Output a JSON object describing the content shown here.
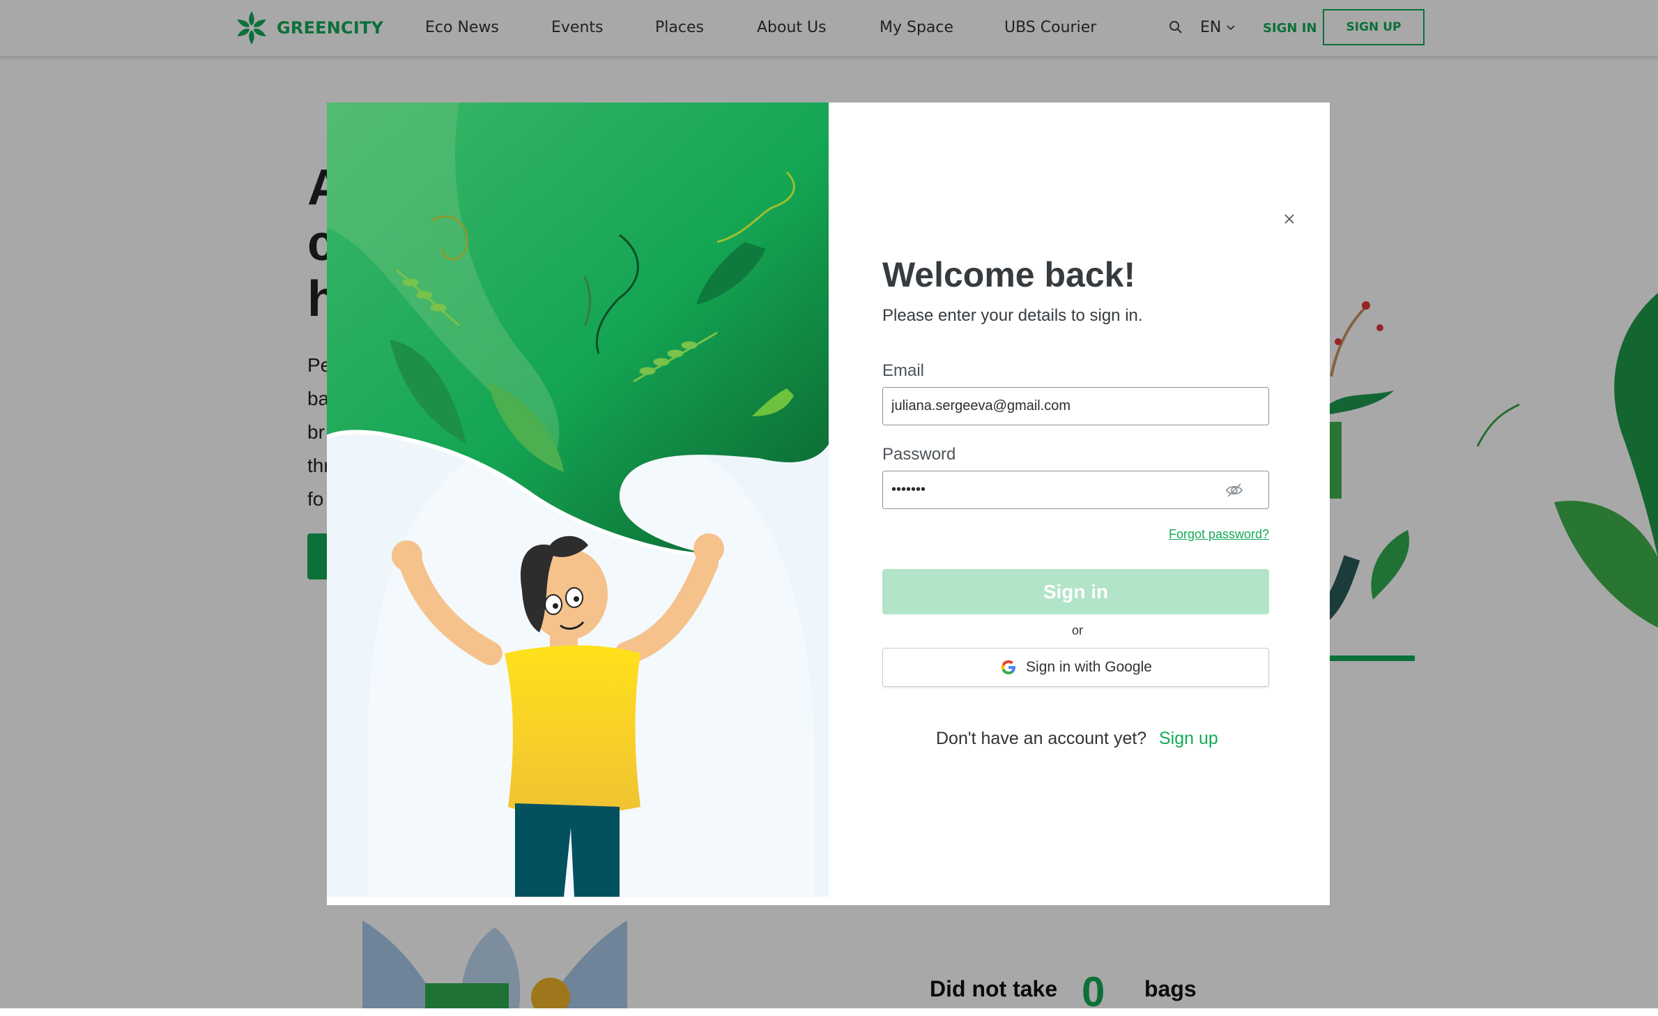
{
  "header": {
    "brand": "GREENCITY",
    "nav": [
      "Eco News",
      "Events",
      "Places",
      "About Us",
      "My Space",
      "UBS Courier"
    ],
    "language": "EN",
    "sign_in": "SIGN IN",
    "sign_up": "SIGN UP"
  },
  "background": {
    "headline_fragments": [
      "A",
      "c",
      "h"
    ],
    "paragraph_fragments": [
      "Pe",
      "ba",
      "br",
      "thr",
      "fo"
    ],
    "stats_label": "Did not take",
    "stats_value": "0",
    "stats_unit": "bags"
  },
  "modal": {
    "title": "Welcome back!",
    "subtitle": "Please enter your details to sign in.",
    "email_label": "Email",
    "email_value": "juliana.sergeeva@gmail.com",
    "password_label": "Password",
    "password_value": "•••••••",
    "forgot_password": "Forgot password?",
    "sign_in_button": "Sign in",
    "or_text": "or",
    "google_button": "Sign in with Google",
    "no_account_text": "Don't have an account yet?",
    "sign_up_link": "Sign up"
  },
  "icons": {
    "logo": "greencity-logo-icon",
    "search": "search-icon",
    "language_chevron": "chevron-down-icon",
    "close": "close-icon",
    "password_toggle": "eye-off-icon",
    "google": "google-icon"
  },
  "colors": {
    "brand_green": "#13aa57",
    "disabled_button": "#b2e4c7",
    "overlay": "rgba(0,0,0,0.34)",
    "text_dark": "#363b3f"
  }
}
